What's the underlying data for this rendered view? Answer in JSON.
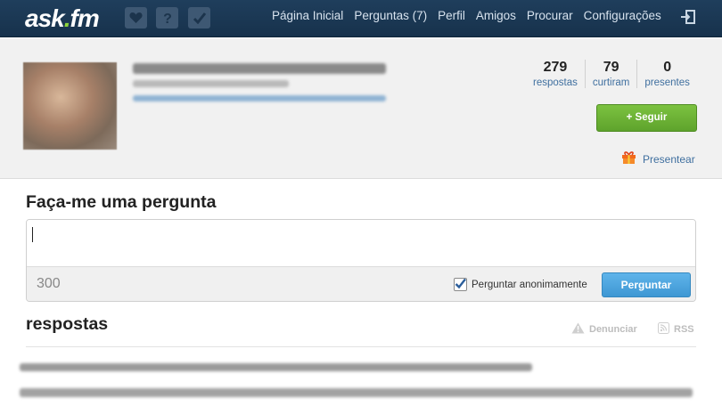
{
  "header": {
    "logo_main": "ask",
    "logo_dot": ".",
    "logo_tld": "fm",
    "icons": [
      "heart-icon",
      "question-icon",
      "check-icon"
    ],
    "nav": [
      {
        "label": "Página Inicial"
      },
      {
        "label": "Perguntas (7)"
      },
      {
        "label": "Perfil"
      },
      {
        "label": "Amigos"
      },
      {
        "label": "Procurar"
      },
      {
        "label": "Configurações"
      }
    ],
    "logout_icon": "logout-icon"
  },
  "profile": {
    "stats": [
      {
        "value": "279",
        "label": "respostas"
      },
      {
        "value": "79",
        "label": "curtiram"
      },
      {
        "value": "0",
        "label": "presentes"
      }
    ],
    "follow_label": "+ Seguir",
    "gift_label": "Presentear"
  },
  "ask": {
    "title": "Faça-me uma pergunta",
    "counter": "300",
    "anon_label": "Perguntar anonimamente",
    "anon_checked": true,
    "submit_label": "Perguntar"
  },
  "answers": {
    "title": "respostas",
    "report_label": "Denunciar",
    "rss_label": "RSS"
  },
  "colors": {
    "topbar": "#1f3e5c",
    "accent_green": "#6fb536",
    "accent_blue": "#4aa5df",
    "link": "#3f6f9f"
  }
}
